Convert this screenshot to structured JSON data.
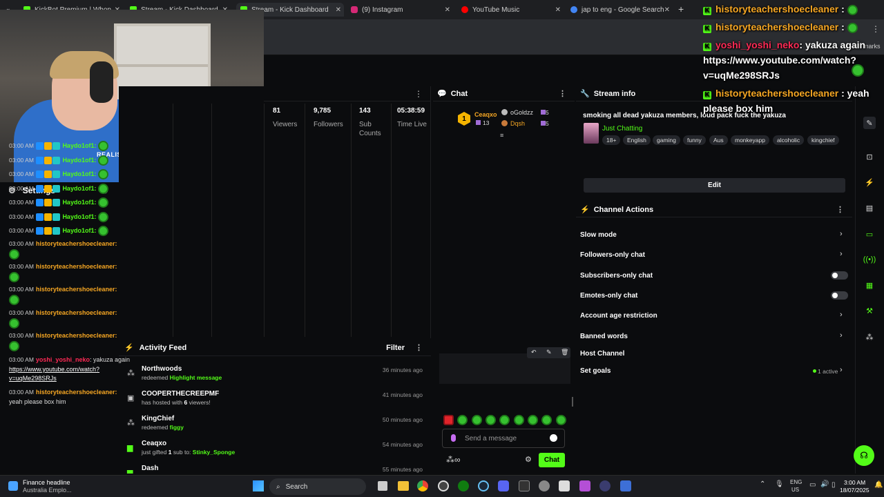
{
  "tabs": [
    {
      "label": "KickBot Premium | Whop",
      "color": "#53fc18"
    },
    {
      "label": "Stream - Kick Dashboard",
      "color": "#53fc18"
    },
    {
      "label": "Stream - Kick Dashboard",
      "color": "#53fc18"
    },
    {
      "label": "(9) Instagram",
      "color": "#d62976"
    },
    {
      "label": "YouTube Music",
      "color": "#ff0000"
    },
    {
      "label": "jap to eng - Google Search",
      "color": "#4285f4"
    }
  ],
  "bookmarks_tail": "marks",
  "settings": {
    "label": "Settings"
  },
  "stats": [
    {
      "value": "81",
      "label": "Viewers"
    },
    {
      "value": "9,785",
      "label": "Followers"
    },
    {
      "value": "143",
      "label": "Sub Counts"
    },
    {
      "value": "05:38:59",
      "label": "Time Live"
    }
  ],
  "activity": {
    "title": "Activity Feed",
    "filter": "Filter",
    "items": [
      {
        "name": "Northwoods",
        "pre": "redeemed",
        "hl": "Highlight message",
        "post": "",
        "hl2": "",
        "time": "36 minutes ago"
      },
      {
        "name": "COOPERTHECREEPMF",
        "pre": "has hosted with",
        "hl": "6",
        "post": "viewers!",
        "hl2": "",
        "time": "41 minutes ago"
      },
      {
        "name": "KingChief",
        "pre": "redeemed",
        "hl": "figgy",
        "post": "",
        "hl2": "",
        "time": "50 minutes ago"
      },
      {
        "name": "Ceaqxo",
        "pre": "just gifted",
        "hl": "1",
        "post": "sub to:",
        "hl2": "Stinky_Sponge",
        "time": "54 minutes ago"
      },
      {
        "name": "Dash",
        "pre": "",
        "hl": "",
        "post": "",
        "hl2": "",
        "time": "55 minutes ago"
      }
    ]
  },
  "chat": {
    "title": "Chat",
    "leaderboard": {
      "first": {
        "rank": "1",
        "name": "Ceaqxo",
        "count": "13"
      },
      "second": {
        "name": "oGoldzz",
        "count": "5"
      },
      "third": {
        "name": "Dqsh",
        "count": "5"
      }
    },
    "messages": [
      {
        "time": "03:00 AM",
        "user": "Haydo1of1:"
      },
      {
        "time": "03:00 AM",
        "user": "Haydo1of1:"
      },
      {
        "time": "03:00 AM",
        "user": "Haydo1of1:"
      },
      {
        "time": "03:00 AM",
        "user": "Haydo1of1:"
      },
      {
        "time": "03:00 AM",
        "user": "Haydo1of1:"
      },
      {
        "time": "03:00 AM",
        "user": "Haydo1of1:"
      },
      {
        "time": "03:00 AM",
        "user": "Haydo1of1:"
      }
    ],
    "hist_messages": [
      {
        "time": "03:00 AM",
        "user": "historyteachershoecleaner:"
      },
      {
        "time": "03:00 AM",
        "user": "historyteachershoecleaner:"
      },
      {
        "time": "03:00 AM",
        "user": "historyteachershoecleaner:"
      },
      {
        "time": "03:00 AM",
        "user": "historyteachershoecleaner:"
      },
      {
        "time": "03:00 AM",
        "user": "historyteachershoecleaner:"
      }
    ],
    "yoshi": {
      "time": "03:00 AM",
      "user": "yoshi_yoshi_neko",
      "text": ": yakuza again",
      "link1": "https://www.youtube.com/watch?",
      "link2": "v=uqMe298SRJs"
    },
    "last": {
      "time": "03:00 AM",
      "user": "historyteachershoecleaner:",
      "text": "yeah please box him"
    },
    "placeholder": "Send a message",
    "send_label": "Chat"
  },
  "stream_info": {
    "title": "Stream info",
    "stream_title": "smoking all dead yakuza members, loud pack fuck the yakuza",
    "category": "Just Chatting",
    "tags": [
      "18+",
      "English",
      "gaming",
      "funny",
      "Aus",
      "monkeyapp",
      "alcoholic",
      "kingchief"
    ],
    "edit": "Edit"
  },
  "channel_actions": {
    "title": "Channel Actions",
    "items": [
      "Slow mode",
      "Followers-only chat",
      "Subscribers-only chat",
      "Emotes-only chat",
      "Account age restriction",
      "Banned words",
      "Host Channel",
      "Set goals"
    ],
    "goals_status": "1 active"
  },
  "overlay": {
    "u1": "historyteachershoecleaner",
    "u2": "historyteachershoecleaner",
    "u3": "yoshi_yoshi_neko",
    "m3": ": yakuza again",
    "l1": "https://www.youtube.com/watch?",
    "l2": "v=uqMe298SRJs",
    "u4": "historyteachershoecleaner",
    "m4a": ": yeah",
    "m4b": "please box him",
    "sep": ":"
  },
  "taskbar": {
    "news_title": "Finance headline",
    "news_sub": "Australia Emplo...",
    "search": "Search",
    "lang1": "ENG",
    "lang2": "US",
    "time": "3:00 AM",
    "date": "18/07/2025"
  }
}
